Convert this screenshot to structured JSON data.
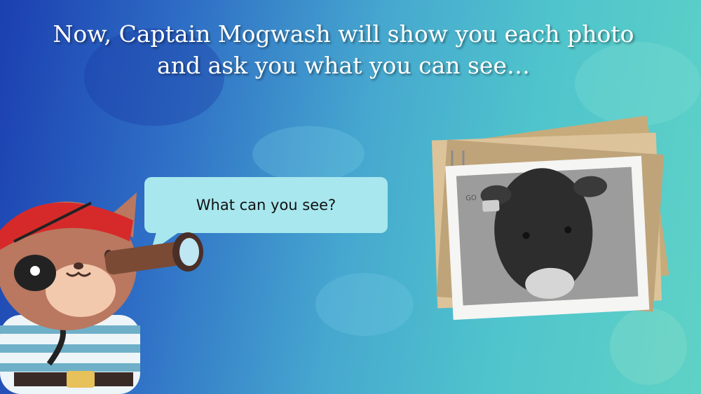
{
  "title_line1": "Now, Captain Mogwash will show you each photo",
  "title_line2": "and ask you what you can see…",
  "speech_bubble_text": "What can you see?",
  "photo_tag_text": "GO",
  "colors": {
    "background_left": "#1b3fb0",
    "background_right": "#5fd2c6",
    "bubble": "#a8e7ee",
    "bandana": "#d62a2a",
    "cat_fur": "#b9785f"
  },
  "icons": {
    "character": "pirate-cat-icon",
    "photo": "cow-photo-icon"
  }
}
